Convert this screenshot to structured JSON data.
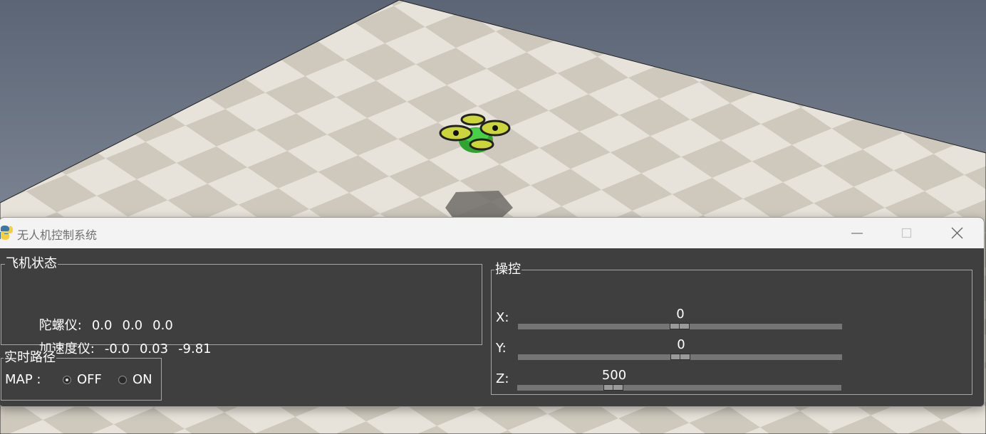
{
  "window": {
    "title": "无人机控制系统"
  },
  "status_group": {
    "legend": "飞机状态",
    "gyro_label": "陀螺仪:",
    "gyro_values": [
      "0.0",
      "0.0",
      "0.0"
    ],
    "accel_label": "加速度仪:",
    "accel_values": [
      "-0.0",
      "0.03",
      "-9.81"
    ]
  },
  "path_group": {
    "legend": "实时路径",
    "map_label": "MAP :",
    "options": [
      {
        "label": "OFF",
        "selected": true
      },
      {
        "label": "ON",
        "selected": false
      }
    ]
  },
  "control_group": {
    "legend": "操控",
    "sliders": [
      {
        "label": "X:",
        "value": "0",
        "min": -1000,
        "max": 1000
      },
      {
        "label": "Y:",
        "value": "0",
        "min": -1000,
        "max": 1000
      },
      {
        "label": "Z:",
        "value": "500",
        "min": 0,
        "max": 2200
      }
    ]
  },
  "colors": {
    "panel": "#3f3f3f",
    "titlebar": "#f3f3f3",
    "drone": "#3cc43c",
    "sky": "#8b93a3"
  },
  "icons": [
    "python-app-icon",
    "minimize-icon",
    "maximize-icon",
    "close-icon",
    "drone-icon"
  ]
}
